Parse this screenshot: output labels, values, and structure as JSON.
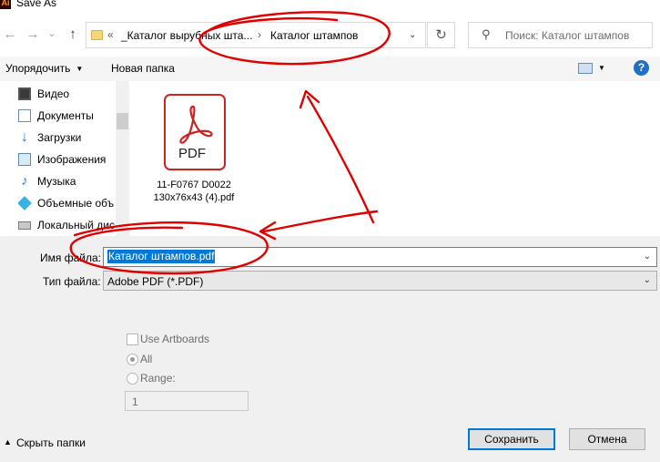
{
  "window": {
    "title": "Save As",
    "app_logo": "Ai"
  },
  "nav": {
    "path_prefix": "«",
    "breadcrumb": [
      "_Каталог вырубных шта...",
      "Каталог штампов"
    ],
    "breadcrumb_sep": "›",
    "search_placeholder": "Поиск: Каталог штампов"
  },
  "toolbar": {
    "organize_label": "Упорядочить",
    "new_folder_label": "Новая папка",
    "help_label": "?"
  },
  "sidebar": {
    "items": [
      {
        "label": "Видео",
        "icon": "video-icon"
      },
      {
        "label": "Документы",
        "icon": "documents-icon"
      },
      {
        "label": "Загрузки",
        "icon": "downloads-icon"
      },
      {
        "label": "Изображения",
        "icon": "images-icon"
      },
      {
        "label": "Музыка",
        "icon": "music-icon"
      },
      {
        "label": "Объемные объ",
        "icon": "3d-objects-icon"
      },
      {
        "label": "Локальный дис",
        "icon": "local-disk-icon"
      }
    ]
  },
  "files": [
    {
      "name_line1": "11-F0767 D0022",
      "name_line2": "130x76x43 (4).pdf",
      "icon_text": "PDF"
    }
  ],
  "form": {
    "filename_label": "Имя файла:",
    "filename_value": "Каталог штампов.pdf",
    "filetype_label": "Тип файла:",
    "filetype_value": "Adobe PDF (*.PDF)"
  },
  "options": {
    "use_artboards_label": "Use Artboards",
    "all_label": "All",
    "range_label": "Range:",
    "range_value": "1"
  },
  "footer": {
    "hide_folders_label": "Скрыть папки",
    "save_label": "Сохранить",
    "cancel_label": "Отмена"
  },
  "colors": {
    "accent": "#0078d7",
    "annotation": "#e00000",
    "pdf_red": "#cc2222"
  }
}
